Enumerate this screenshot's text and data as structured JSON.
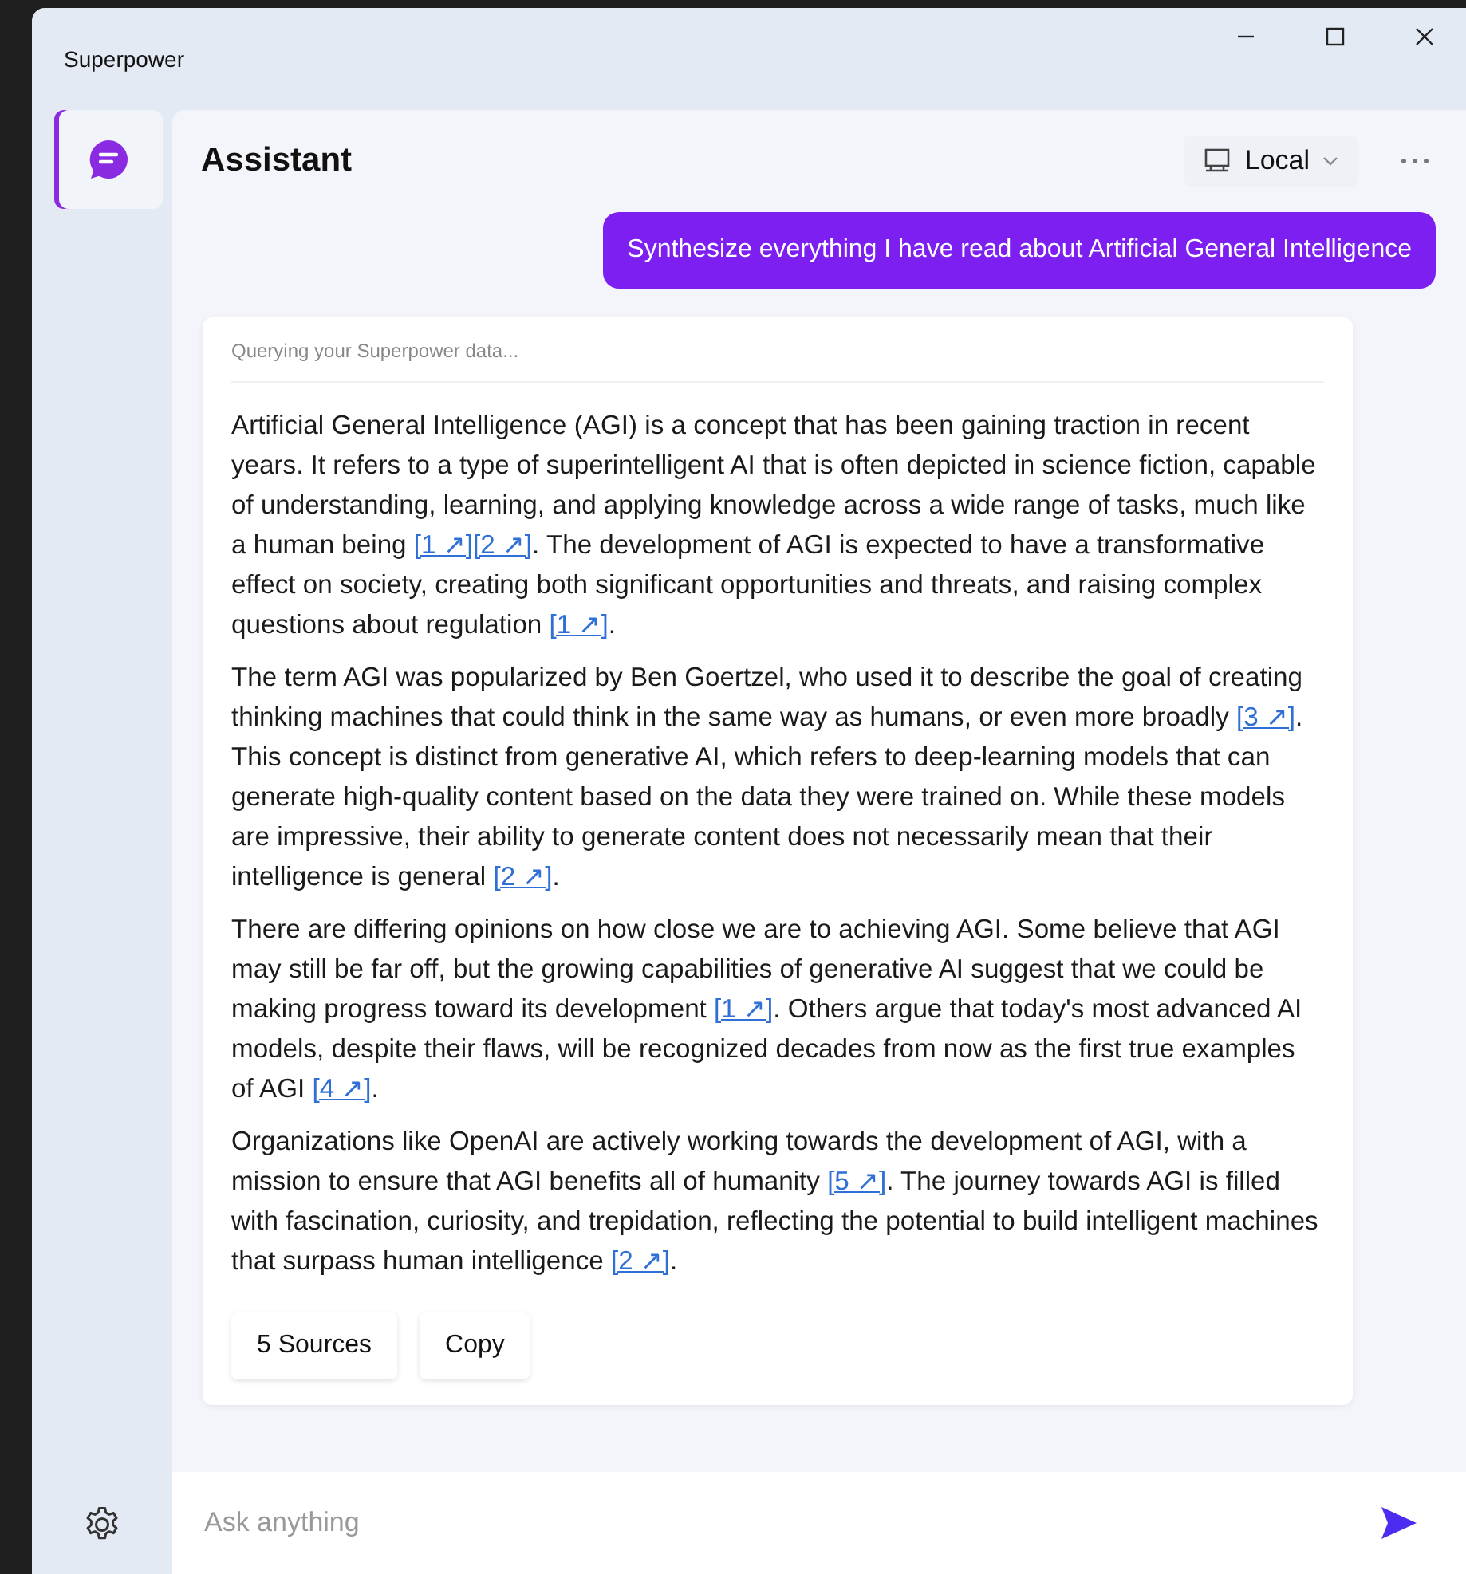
{
  "window": {
    "title": "Superpower"
  },
  "sidebar": {
    "items": [
      {
        "kind": "chat",
        "selected": true
      }
    ]
  },
  "header": {
    "title": "Assistant",
    "model": "Local"
  },
  "user_message": "Synthesize everything I have read about Artificial General Intelligence",
  "answer": {
    "status": "Querying your Superpower data...",
    "paragraphs": [
      [
        {
          "kind": "text",
          "text": "Artificial General Intelligence (AGI) is a concept that has been gaining traction in recent years. It refers to a type of superintelligent AI that is often depicted in science fiction, capable of understanding, learning, and applying knowledge across a wide range of tasks, much like a human being "
        },
        {
          "kind": "cite",
          "text": "[1 ↗]"
        },
        {
          "kind": "cite",
          "text": "[2 ↗]"
        },
        {
          "kind": "text",
          "text": ". The development of AGI is expected to have a transformative effect on society, creating both significant opportunities and threats, and raising complex questions about regulation "
        },
        {
          "kind": "cite",
          "text": "[1 ↗]"
        },
        {
          "kind": "text",
          "text": "."
        }
      ],
      [
        {
          "kind": "text",
          "text": "The term AGI was popularized by Ben Goertzel, who used it to describe the goal of creating thinking machines that could think in the same way as humans, or even more broadly "
        },
        {
          "kind": "cite",
          "text": "[3 ↗]"
        },
        {
          "kind": "text",
          "text": ". This concept is distinct from generative AI, which refers to deep-learning models that can generate high-quality content based on the data they were trained on. While these models are impressive, their ability to generate content does not necessarily mean that their intelligence is general "
        },
        {
          "kind": "cite",
          "text": "[2 ↗]"
        },
        {
          "kind": "text",
          "text": "."
        }
      ],
      [
        {
          "kind": "text",
          "text": "There are differing opinions on how close we are to achieving AGI. Some believe that AGI may still be far off, but the growing capabilities of generative AI suggest that we could be making progress toward its development "
        },
        {
          "kind": "cite",
          "text": "[1 ↗]"
        },
        {
          "kind": "text",
          "text": ". Others argue that today's most advanced AI models, despite their flaws, will be recognized decades from now as the first true examples of AGI "
        },
        {
          "kind": "cite",
          "text": "[4 ↗]"
        },
        {
          "kind": "text",
          "text": "."
        }
      ],
      [
        {
          "kind": "text",
          "text": "Organizations like OpenAI are actively working towards the development of AGI, with a mission to ensure that AGI benefits all of humanity "
        },
        {
          "kind": "cite",
          "text": "[5 ↗]"
        },
        {
          "kind": "text",
          "text": ". The journey towards AGI is filled with fascination, curiosity, and trepidation, reflecting the potential to build intelligent machines that surpass human intelligence "
        },
        {
          "kind": "cite",
          "text": "[2 ↗]"
        },
        {
          "kind": "text",
          "text": "."
        }
      ]
    ],
    "buttons": [
      "5 Sources",
      "Copy"
    ]
  },
  "input": {
    "placeholder": "Ask anything"
  }
}
